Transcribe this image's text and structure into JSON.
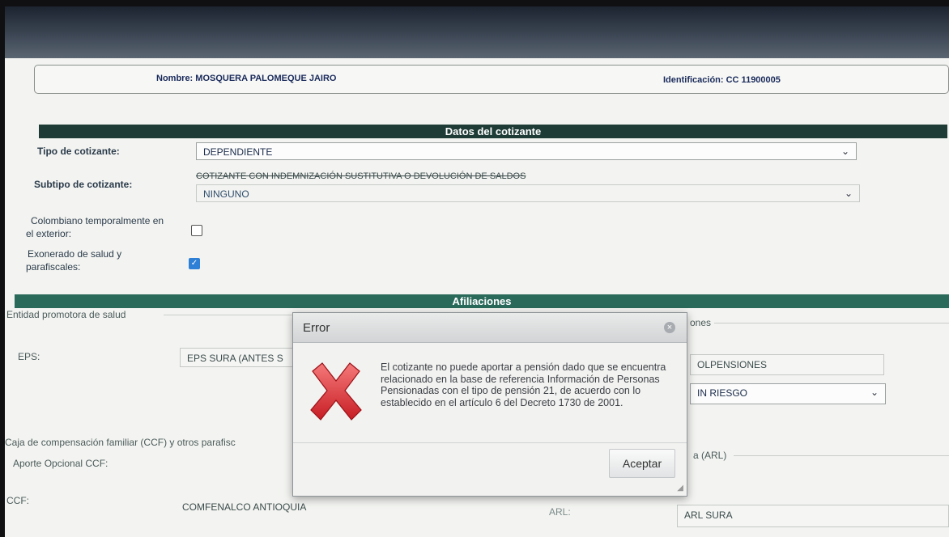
{
  "header": {
    "nombre": "Nombre: MOSQUERA PALOMEQUE JAIRO",
    "identificacion": "Identificación: CC 11900005"
  },
  "cotizante": {
    "section_title": "Datos del cotizante",
    "tipo_label": "Tipo de cotizante:",
    "tipo_value": "DEPENDIENTE",
    "subtipo_label": "Subtipo de cotizante:",
    "subtipo_strike": "COTIZANTE CON INDEMNIZACIÓN SUSTITUTIVA O DEVOLUCIÓN DE SALDOS",
    "subtipo_value": "NINGUNO",
    "colombiano_label_1": "Colombiano temporalmente en",
    "colombiano_label_2": "el exterior:",
    "exonerado_label_1": "Exonerado de salud y",
    "exonerado_label_2": "parafiscales:",
    "colombiano_checked": false,
    "exonerado_checked": true
  },
  "afiliaciones": {
    "section_title": "Afiliaciones",
    "eps_section": "Entidad promotora de salud",
    "pension_section_tail": "ones",
    "eps_label": "EPS:",
    "eps_value": "EPS SURA (ANTES S",
    "pension_value": "OLPENSIONES",
    "riesgo_value": "IN RIESGO",
    "ccf_section": "Caja de compensación familiar (CCF) y otros parafisc",
    "arl_section_tail": "a (ARL)",
    "aporte_label": "Aporte Opcional CCF:",
    "ccf_label": "CCF:",
    "ccf_value": "COMFENALCO ANTIOQUIA",
    "arl_label": "ARL:",
    "arl_value": "ARL SURA"
  },
  "modal": {
    "title": "Error",
    "message": "El cotizante no puede aportar a pensión dado que se encuentra relacionado en la base de referencia Información de Personas Pensionadas con el tipo de pensión 21, de acuerdo con lo establecido en el artículo 6 del Decreto 1730 de 2001.",
    "button": "Aceptar",
    "icons": {
      "close": "close-icon",
      "error": "error-x-icon"
    }
  }
}
